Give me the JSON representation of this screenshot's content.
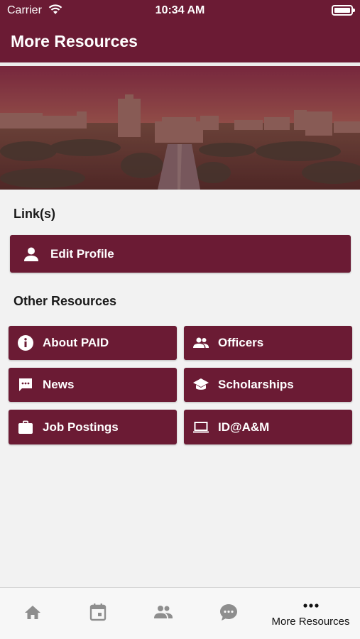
{
  "status_bar": {
    "carrier": "Carrier",
    "time": "10:34 AM"
  },
  "header": {
    "title": "More Resources"
  },
  "links_section": {
    "title": "Link(s)",
    "items": [
      {
        "label": "Edit Profile",
        "icon": "person-icon"
      }
    ]
  },
  "other_section": {
    "title": "Other Resources",
    "items": [
      {
        "label": "About PAID",
        "icon": "info-icon"
      },
      {
        "label": "Officers",
        "icon": "people-icon"
      },
      {
        "label": "News",
        "icon": "chat-icon"
      },
      {
        "label": "Scholarships",
        "icon": "graduation-cap-icon"
      },
      {
        "label": "Job Postings",
        "icon": "briefcase-icon"
      },
      {
        "label": "ID@A&M",
        "icon": "laptop-icon"
      }
    ]
  },
  "tab_bar": {
    "items": [
      {
        "icon": "home-icon",
        "label": ""
      },
      {
        "icon": "calendar-icon",
        "label": ""
      },
      {
        "icon": "people-icon",
        "label": ""
      },
      {
        "icon": "chat-bubble-icon",
        "label": ""
      },
      {
        "icon": "more-icon",
        "label": "More Resources",
        "selected": true
      }
    ]
  },
  "colors": {
    "brand": "#6b1b34",
    "background": "#f2f2f2",
    "tab_inactive": "#8e8e8e"
  }
}
